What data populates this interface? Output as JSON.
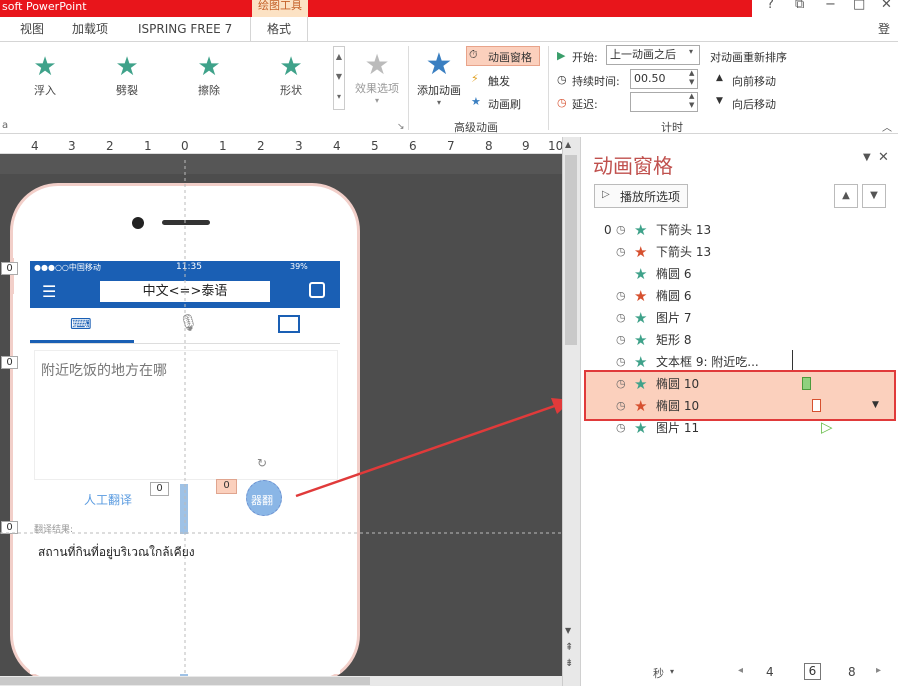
{
  "app_title": "soft PowerPoint",
  "context_tab": "绘图工具",
  "window": {
    "help": "?",
    "restore": "⧉",
    "minimize": "−",
    "maximize": "□",
    "close": "✕"
  },
  "tabs": [
    "视图",
    "加载项",
    "ISPRING FREE 7",
    "格式"
  ],
  "login": "登录",
  "ribbon": {
    "effects": [
      {
        "label": "浮入",
        "icon": "star-icon"
      },
      {
        "label": "劈裂",
        "icon": "star-icon"
      },
      {
        "label": "擦除",
        "icon": "star-icon"
      },
      {
        "label": "形状",
        "icon": "star-icon"
      }
    ],
    "effect_options": "效果选项",
    "add_animation": "添加动画",
    "animation_pane": "动画窗格",
    "trigger": "触发",
    "anim_painter": "动画刷",
    "group_advanced": "高级动画",
    "start_label": "开始:",
    "start_value": "上一动画之后",
    "duration_label": "持续时间:",
    "duration_value": "00.50",
    "delay_label": "延迟:",
    "delay_value": "",
    "group_timing": "计时",
    "reorder_title": "对动画重新排序",
    "move_earlier": "向前移动",
    "move_later": "向后移动"
  },
  "ruler": [
    "4",
    "3",
    "2",
    "1",
    "0",
    "1",
    "2",
    "3",
    "4",
    "5",
    "6",
    "7",
    "8",
    "9",
    "10"
  ],
  "slide": {
    "status_left": "●●●○○中国移动",
    "status_time": "11:35",
    "status_right": "39%",
    "translate_title": "中文<=>泰语",
    "source_text": "附近吃饭的地方在哪",
    "human_translate": "人工翻译",
    "machine_translate": "器翻",
    "result_label": "翻译结果:",
    "result_text": "สถานที่กินที่อยู่บริเวณใกล้เคียง",
    "tags": [
      "0",
      "0",
      "0",
      "0",
      "0"
    ]
  },
  "pane": {
    "title": "动画窗格",
    "play_selected": "播放所选项",
    "items": [
      {
        "num": "0",
        "clock": true,
        "star": "green",
        "name": "下箭头 13"
      },
      {
        "num": "",
        "clock": true,
        "star": "red",
        "name": "下箭头 13"
      },
      {
        "num": "",
        "clock": false,
        "star": "green",
        "name": "椭圆 6"
      },
      {
        "num": "",
        "clock": true,
        "star": "red",
        "name": "椭圆 6"
      },
      {
        "num": "",
        "clock": true,
        "star": "green",
        "name": "图片 7"
      },
      {
        "num": "",
        "clock": true,
        "star": "green",
        "name": "矩形 8"
      },
      {
        "num": "",
        "clock": true,
        "star": "green",
        "name": "文本框 9: 附近吃..."
      },
      {
        "num": "",
        "clock": true,
        "star": "green",
        "name": "椭圆 10"
      },
      {
        "num": "",
        "clock": true,
        "star": "red",
        "name": "椭圆 10"
      },
      {
        "num": "",
        "clock": true,
        "star": "green",
        "name": "图片 11"
      }
    ],
    "seconds": "秒",
    "timeline": [
      "4",
      "6",
      "8"
    ]
  },
  "colors": {
    "title_red": "#e8151b",
    "accent": "#c0504d",
    "green_star": "#3fa28a",
    "red_star": "#d6502f",
    "highlight": "#fbd0bd",
    "phone_blue": "#1a5fb4"
  }
}
